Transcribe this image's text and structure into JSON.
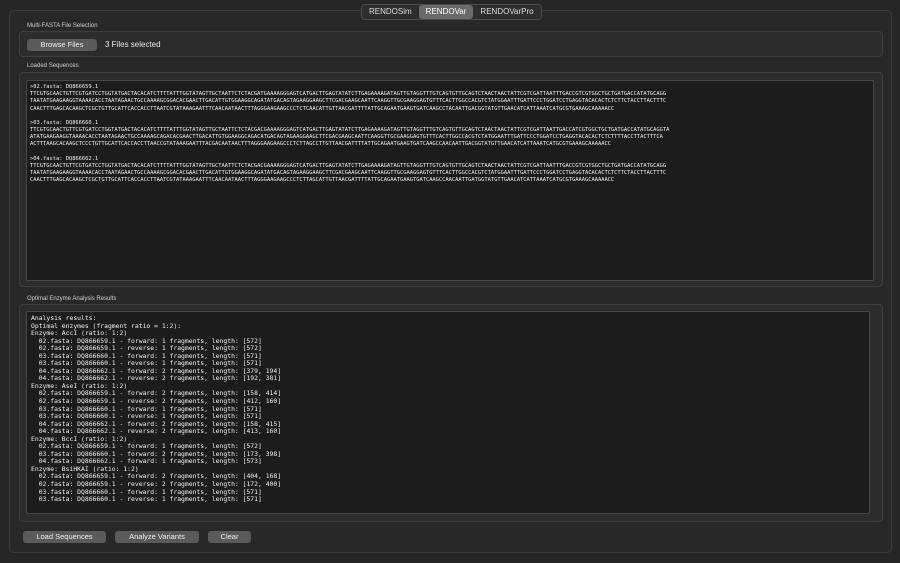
{
  "tabs": [
    {
      "label": "RENDOSim",
      "active": false
    },
    {
      "label": "RENDOVar",
      "active": true
    },
    {
      "label": "RENDOVarPro",
      "active": false
    }
  ],
  "file_selection": {
    "group_label": "Multi-FASTA File Selection",
    "browse_label": "Browse Files",
    "status": "3 Files selected"
  },
  "sequences": {
    "group_label": "Loaded Sequences",
    "items": [
      {
        "header": ">02.fasta: DQ866659.1",
        "lines": [
          "TTCGTGCAACTGTTCGTGATCCTGGTATGACTACACATCTTTTATTTGGTATAGTTGCTAATTCTCTACGATGAAAAGGGAGTCATGACTTGAGTATATCTTGAGAAAAGATAGTTGTAGGTTTGTCAGTGTTGCAGTCTAACTAACTATTCGTCGATTAATTTGACCGTCGTGGCTGCTGATGACCATATGCAGG",
          "TAATATGAAGAAGGTAAAACACCTAATAGAACTGCCAAAAGCGGACACGAACTTGACATTGTGGAAGGCAGATATGACAGTAGAAGGAAGCTTCGACGAAGCAATTCAAGGTTGCGAAGGAGTGTTTCACTTGGCCACGTCTATGGAATTTGATTCCCTGGATCCTGAGGTACACACTCTCTTCTACCTTACTTTC",
          "CAACTTTGAGCACAAGCTCGCTGTTGCATTCACCACCTTAATCGTATAAAGAATTTCAACAATAACTTTAGGGAAGAAGCCCTCTCAACATTGTTAACGATTTTATTGCAGAATGAAGTGATCAAGCCTACAATTGACGGTATGTTGAACATCATTAAATCATGCGTGAAAGCAAAAACC"
        ]
      },
      {
        "header": ">03.fasta: DQ866660.1",
        "lines": [
          "TTCGTGCAACTGTTCGTGATCCTGGTATGACTACACATCTTTTATTTGGTATAGTTGCTAATTCTCTACGACGAAAAGGGAGTCATGACTTGAGTATATCTTGAGAAAAGATAGTTGTAGGTTTGTCAGTGTTGCAGTCTAACTAACTATTCGTCGATTAATTGACCATCGTGGCTGCTGATGACCATATGCAGGTA",
          "ATATGAAGAAGGTAAAACACCTAATAGAACTGCCAAAAGCAGACACGAACTTGACATTGTGGAAGGCAGACATGACAGTAGAAGGAAGCTTCGACGAAGCAATTCAAGGTTGCGAAGGAGTGTTTCACTTGGCCACGTCTATGGAATTTGATTCCCTGGATCCTGAGGTACACACTCTCTTTTACCTTACTTTCA",
          "ACTTTAAGCACAAGCTCCCTGTTGCATTCACCACCTTAACCGTATAAAGAATTTACGACAATAACTTTAGGGAAGAAGCCCTCTTAGCCTTGTTAACGATTTTATTGCAGAATGAAGTGATCAAGCCAACAATTGACGGTATGTTGAACATCATTAAATCATGCGTGAAAGCAAAAACC"
        ]
      },
      {
        "header": ">04.fasta: DQ866662.1",
        "lines": [
          "TTCGTGCAACTGTTCGTGATCCTGGTATGACTACACATCTTTTATTTGGTATAGTTGCTAATTCTCTACGACGAAAAGGGAGTCATGACTTGAGTATATCTTGAGAAAAGATAGTTGTAGGTTTGTCAGTGTTGCAGTCTAACTAACTATTCGTCGATTAATTTGACCGTCGTGGCTGCTGATGACCATATGCAGG",
          "TAATATGAAGAAGGTAAAACACCTAATAGAACTGCCAAAAGCGGACACGAACTTGACATTGTGGAAGGCAGATATGACAGTAGAAGGAAGCTTCGACGAAGCAATTCAAGGTTGCGAAGGAGTGTTTCACTTGGCCACGTCTATGGAATTTGATTCCCTGGATCCTGAGGTACACACTCTCTTCTACCTTACTTTC",
          "CAACTTTGAGCACAAGCTCGCTGTTGCATTCACCACCTTAATCGTATAAAGAATTTCAACAATAACTTTAGGGAAGAAGCCCTCTTAGCATTGTTAACGATTTTATTGCAGAATGAAGTGATCAAGCCAACAATTGATGGTATGTTGAACATCATTAAATCATGCGTGAAAGCAAAAACC"
        ]
      }
    ]
  },
  "results": {
    "group_label": "Optimal Enzyme Analysis Results",
    "lines": [
      "Analysis results:",
      "Optimal enzymes (fragment ratio = 1:2):",
      "Enzyme: AccI (ratio: 1:2)",
      "  02.fasta: DQ866659.1 - forward: 1 fragments, length: [572]",
      "  02.fasta: DQ866659.1 - reverse: 1 fragments, length: [572]",
      "  03.fasta: DQ866660.1 - forward: 1 fragments, length: [571]",
      "  03.fasta: DQ866660.1 - reverse: 1 fragments, length: [571]",
      "  04.fasta: DQ866662.1 - forward: 2 fragments, length: [379, 194]",
      "  04.fasta: DQ866662.1 - reverse: 2 fragments, length: [192, 381]",
      "Enzyme: AseI (ratio: 1:2)",
      "  02.fasta: DQ866659.1 - forward: 2 fragments, length: [158, 414]",
      "  02.fasta: DQ866659.1 - reverse: 2 fragments, length: [412, 160]",
      "  03.fasta: DQ866660.1 - forward: 1 fragments, length: [571]",
      "  03.fasta: DQ866660.1 - reverse: 1 fragments, length: [571]",
      "  04.fasta: DQ866662.1 - forward: 2 fragments, length: [158, 415]",
      "  04.fasta: DQ866662.1 - reverse: 2 fragments, length: [413, 160]",
      "Enzyme: BccI (ratio: 1:2)",
      "  02.fasta: DQ866659.1 - forward: 1 fragments, length: [572]",
      "  03.fasta: DQ866660.1 - forward: 2 fragments, length: [173, 398]",
      "  04.fasta: DQ866662.1 - forward: 1 fragments, length: [573]",
      "Enzyme: BsiHKAI (ratio: 1:2)",
      "  02.fasta: DQ866659.1 - forward: 2 fragments, length: [404, 168]",
      "  02.fasta: DQ866659.1 - reverse: 2 fragments, length: [172, 400]",
      "  03.fasta: DQ866660.1 - forward: 1 fragments, length: [571]",
      "  03.fasta: DQ866660.1 - reverse: 1 fragments, length: [571]"
    ]
  },
  "actions": {
    "load_label": "Load Sequences",
    "analyze_label": "Analyze Variants",
    "clear_label": "Clear"
  }
}
